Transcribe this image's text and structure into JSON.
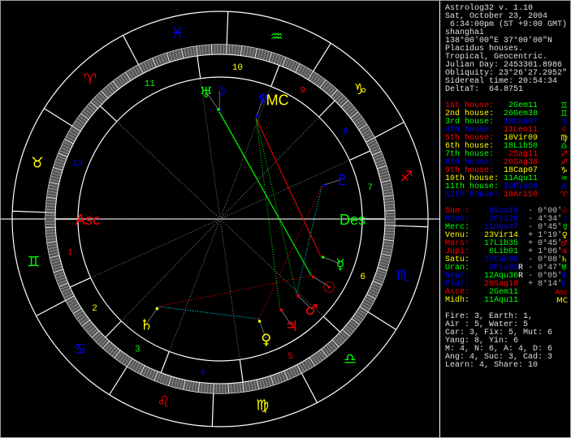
{
  "header": {
    "title": "Astrolog32 v. 1.10",
    "date": "Sat, October 23, 2004",
    "time": " 6:34:00pm (ST +9:00 GMT)",
    "place": "shanghai",
    "coords": "138°00'00\"E 37°00'00\"N",
    "houses": "Placidus houses.",
    "zodiac": "Tropical, Geocentric.",
    "julian": "Julian Day: 2453301.8986",
    "obliquity": "Obliquity: 23°26'27.2952\"",
    "sidereal": "Sidereal time: 20:54:34",
    "deltat": "DeltaT:  64.8751"
  },
  "colors": {
    "fire": "#ff0000",
    "earth": "#ffff00",
    "air": "#00ff00",
    "water": "#0000ff",
    "text": "#e0e0e0",
    "gray": "#c0c0c0"
  },
  "signs": [
    {
      "name": "Aries",
      "glyph": "♈",
      "el": "fire"
    },
    {
      "name": "Taurus",
      "glyph": "♉",
      "el": "earth"
    },
    {
      "name": "Gemini",
      "glyph": "♊",
      "el": "air"
    },
    {
      "name": "Cancer",
      "glyph": "♋",
      "el": "water"
    },
    {
      "name": "Leo",
      "glyph": "♌",
      "el": "fire"
    },
    {
      "name": "Virgo",
      "glyph": "♍",
      "el": "earth"
    },
    {
      "name": "Libra",
      "glyph": "♎",
      "el": "air"
    },
    {
      "name": "Scorpio",
      "glyph": "♏",
      "el": "water"
    },
    {
      "name": "Sagittarius",
      "glyph": "♐",
      "el": "fire"
    },
    {
      "name": "Capricorn",
      "glyph": "♑",
      "el": "earth"
    },
    {
      "name": "Aquarius",
      "glyph": "♒",
      "el": "air"
    },
    {
      "name": "Pisces",
      "glyph": "♓",
      "el": "water"
    }
  ],
  "houses": [
    {
      "label": "1st house: ",
      "value": " 2Gem11",
      "lon": 62.18,
      "num": "1"
    },
    {
      "label": "2nd house: ",
      "value": "26Gem38",
      "lon": 86.63,
      "num": "2"
    },
    {
      "label": "3rd house: ",
      "value": "18Can07",
      "lon": 108.12,
      "num": "3"
    },
    {
      "label": "4th house: ",
      "value": "11Leo11",
      "lon": 131.18,
      "num": "4"
    },
    {
      "label": "5th house: ",
      "value": "10Vir09",
      "lon": 160.15,
      "num": "5"
    },
    {
      "label": "6th house: ",
      "value": "18Lib50",
      "lon": 198.83,
      "num": "6"
    },
    {
      "label": "7th house: ",
      "value": " 2Sag11",
      "lon": 242.18,
      "num": "7"
    },
    {
      "label": "8th house: ",
      "value": "26Sag38",
      "lon": 266.63,
      "num": "8"
    },
    {
      "label": "9th house: ",
      "value": "18Cap07",
      "lon": 288.12,
      "num": "9"
    },
    {
      "label": "10th house:",
      "value": "11Aqu11",
      "lon": 311.18,
      "num": "10"
    },
    {
      "label": "11th house:",
      "value": "10Pis09",
      "lon": 340.15,
      "num": "11"
    },
    {
      "label": "12th house:",
      "value": "18Ari50",
      "lon": 18.83,
      "num": "12"
    }
  ],
  "planets": [
    {
      "name": "Sun :",
      "value": " 0Sco19",
      "retro": " ",
      "lat": "- 0°00'",
      "glyph": "☉",
      "color": "#ff0000",
      "lon": 210.32
    },
    {
      "name": "Moon:",
      "value": " 2Pis29",
      "retro": " ",
      "lat": "- 4°34'",
      "glyph": "☽",
      "color": "#0000ff",
      "lon": 332.48
    },
    {
      "name": "Merc:",
      "value": "11Sco47",
      "retro": " ",
      "lat": "- 0°45'",
      "glyph": "☿",
      "color": "#00ff00",
      "lon": 221.78
    },
    {
      "name": "Venu:",
      "value": "23Vir14",
      "retro": " ",
      "lat": "+ 1°19'",
      "glyph": "♀",
      "color": "#ffff00",
      "lon": 173.23
    },
    {
      "name": "Mars:",
      "value": "17Lib35",
      "retro": " ",
      "lat": "+ 0°45'",
      "glyph": "♂",
      "color": "#ff0000",
      "lon": 197.58
    },
    {
      "name": "Jupi:",
      "value": " 6Lib01",
      "retro": " ",
      "lat": "+ 1°06'",
      "glyph": "♃",
      "color": "#ff0000",
      "lon": 186.02
    },
    {
      "name": "Satu:",
      "value": "27Can06",
      "retro": " ",
      "lat": "- 0°08'",
      "glyph": "♄",
      "color": "#ffff00",
      "lon": 117.1
    },
    {
      "name": "Uran:",
      "value": " 3Pis02",
      "retro": "R",
      "lat": "- 0°47'",
      "glyph": "♅",
      "color": "#00ff00",
      "lon": 333.03
    },
    {
      "name": "Nept:",
      "value": "12Aqu36",
      "retro": "R",
      "lat": "- 0°05'",
      "glyph": "♆",
      "color": "#0000ff",
      "lon": 312.6
    },
    {
      "name": "Plut:",
      "value": "20Sag18",
      "retro": " ",
      "lat": "+ 8°14'",
      "glyph": "♇",
      "color": "#0000ff",
      "lon": 260.3
    }
  ],
  "angles": [
    {
      "name": "Asce:",
      "value": " 2Gem11",
      "glyph": "Asc",
      "color": "#ff0000"
    },
    {
      "name": "Midh:",
      "value": "11Aqu11",
      "glyph": "MC",
      "color": "#ffff00"
    }
  ],
  "chart_labels": {
    "asc": "Asc",
    "des": "Des",
    "mc": "MC"
  },
  "summary": [
    "Fire: 3, Earth: 1,",
    "Air : 5, Water: 5",
    "Car: 3, Fix: 5, Mut: 6",
    "Yang: 8, Yin: 6",
    "M: 4, N: 6, A: 4, D: 6",
    "Ang: 4, Suc: 3, Cad: 3",
    "Learn: 4, Share: 10"
  ]
}
